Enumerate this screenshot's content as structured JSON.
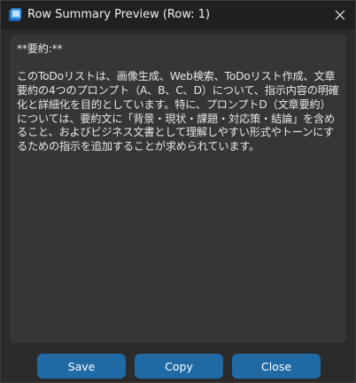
{
  "window": {
    "title": "Row Summary Preview (Row: 1)",
    "close_icon": "close-icon"
  },
  "summary": {
    "text": "**要約:**\n\nこのToDoリストは、画像生成、Web検索、ToDoリスト作成、文章要約の4つのプロンプト（A、B、C、D）について、指示内容の明確化と詳細化を目的としています。特に、プロンプトD（文章要約）については、要約文に「背景・現状・課題・対応策・結論」を含めること、およびビジネス文書として理解しやすい形式やトーンにするための指示を追加することが求められています。"
  },
  "buttons": {
    "save": "Save",
    "copy": "Copy",
    "close": "Close"
  },
  "colors": {
    "titlebar": "#202020",
    "background": "#2b2b2b",
    "textbox": "#343638",
    "button": "#1f6aa5"
  }
}
